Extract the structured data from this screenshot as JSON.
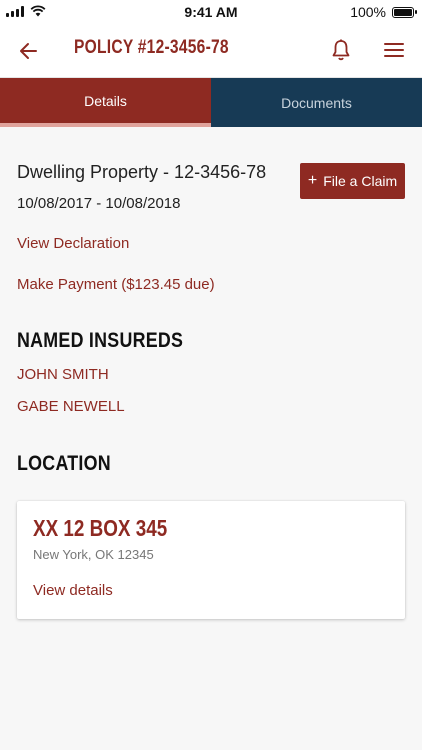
{
  "status_bar": {
    "time": "9:41 AM",
    "battery_text": "100%",
    "battery_level": 1.0,
    "icons": [
      "signal-icon",
      "wifi-icon",
      "battery-icon"
    ]
  },
  "navbar": {
    "title": "POLICY #12-3456-78",
    "icons": [
      "back-arrow-icon",
      "bell-icon",
      "menu-icon"
    ]
  },
  "tabs": [
    {
      "label": "Details",
      "active": true
    },
    {
      "label": "Documents",
      "active": false
    }
  ],
  "policy": {
    "title": "Dwelling Property - 12-3456-78",
    "dates": "10/08/2017 - 10/08/2018",
    "claim_button_label": "File a Claim",
    "view_declaration_label": "View Declaration",
    "make_payment_label": "Make Payment ($123.45 due)"
  },
  "named_insureds": {
    "heading": "NAMED INSUREDS",
    "items": [
      "JOHN SMITH",
      "GABE NEWELL"
    ]
  },
  "location": {
    "heading": "LOCATION",
    "address": "XX 12 BOX 345",
    "city": "New York, OK 12345",
    "details_link": "View details"
  },
  "colors": {
    "brand_red": "#8e2a22",
    "brand_navy": "#173a55",
    "background": "#f7f7f7"
  }
}
